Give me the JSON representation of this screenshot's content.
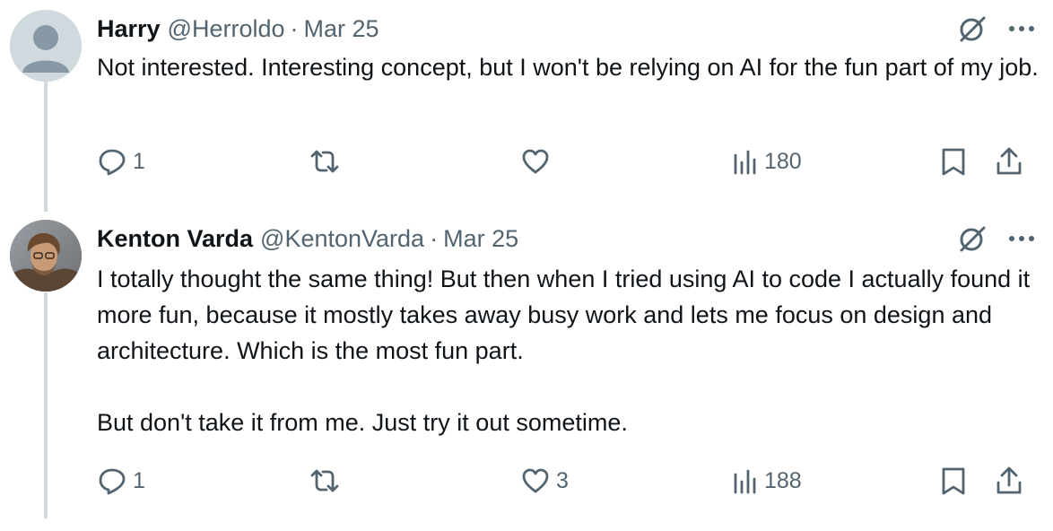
{
  "tweets": [
    {
      "name": "Harry",
      "handle": "@Herroldo",
      "separator": "·",
      "date": "Mar 25",
      "paragraphs": [
        "Not interested.  Interesting concept, but I won't be relying on AI for the fun part of my job."
      ],
      "replies": "1",
      "retweets": "",
      "likes": "",
      "views": "180",
      "avatar_icon": "default-user-icon"
    },
    {
      "name": "Kenton Varda",
      "handle": "@KentonVarda",
      "separator": "·",
      "date": "Mar 25",
      "paragraphs": [
        "I totally thought the same thing! But then when I tried using AI to code I actually found it more fun, because it mostly takes away busy work and lets me focus on design and architecture. Which is the most fun part.",
        "But don't take it from me. Just try it out sometime."
      ],
      "replies": "1",
      "retweets": "",
      "likes": "3",
      "views": "188",
      "avatar_icon": "user-photo"
    }
  ],
  "colors": {
    "text": "#0f1419",
    "muted": "#536471",
    "thread_line": "#cfd9de"
  }
}
